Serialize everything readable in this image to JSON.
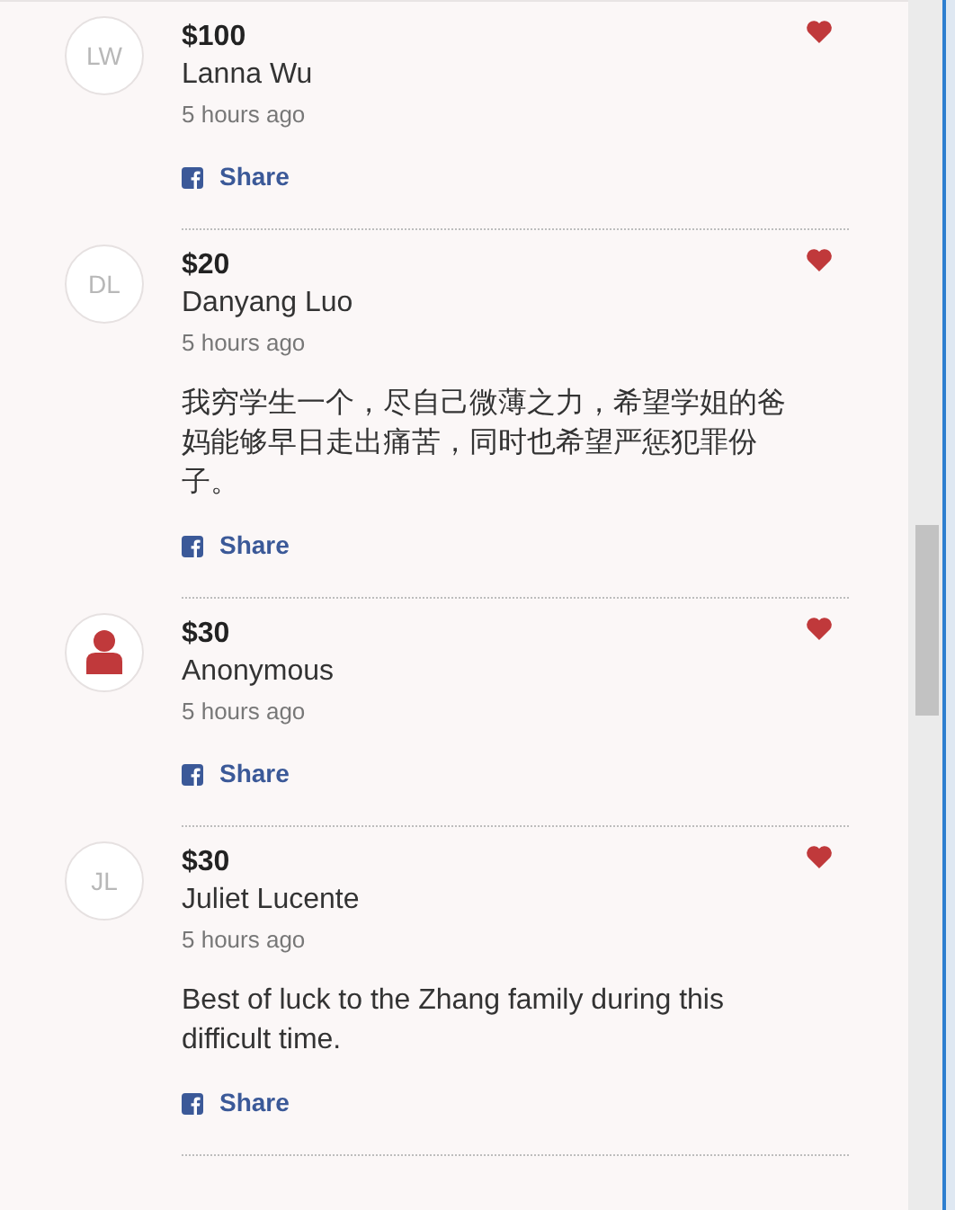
{
  "donations": [
    {
      "avatar": {
        "kind": "initials",
        "initials": "LW"
      },
      "amount": "$100",
      "name": "Lanna Wu",
      "time": "5 hours ago",
      "share": "Share"
    },
    {
      "avatar": {
        "kind": "initials",
        "initials": "DL"
      },
      "amount": "$20",
      "name": "Danyang Luo",
      "time": "5 hours ago",
      "message": "我穷学生一个，尽自己微薄之力，希望学姐的爸妈能够早日走出痛苦，同时也希望严惩犯罪份子。",
      "share": "Share"
    },
    {
      "avatar": {
        "kind": "anonymous"
      },
      "amount": "$30",
      "name": "Anonymous",
      "time": "5 hours ago",
      "share": "Share"
    },
    {
      "avatar": {
        "kind": "initials",
        "initials": "JL"
      },
      "amount": "$30",
      "name": "Juliet Lucente",
      "time": "5 hours ago",
      "message": "Best of luck to the Zhang family during this difficult time.",
      "share": "Share"
    }
  ]
}
